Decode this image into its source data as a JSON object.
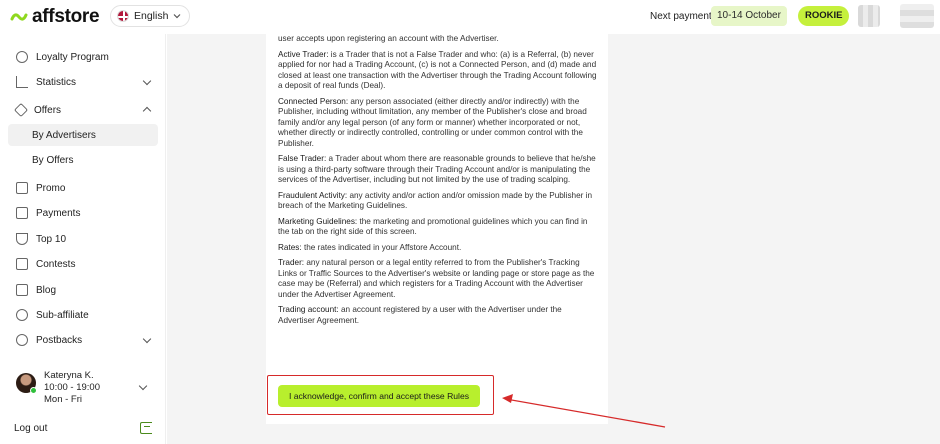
{
  "header": {
    "logo_text": "affstore",
    "language": "English",
    "next_payment_label": "Next payment",
    "next_payment_dates": "10-14 October",
    "rank_badge": "ROOKIE"
  },
  "sidebar": {
    "items": [
      {
        "label": "Loyalty Program",
        "icon": "loyalty-icon"
      },
      {
        "label": "Statistics",
        "icon": "statistics-icon"
      },
      {
        "label": "Offers",
        "icon": "tag-icon"
      },
      {
        "label": "By Advertisers",
        "sub": true,
        "active": true
      },
      {
        "label": "By Offers",
        "sub": true
      },
      {
        "label": "Promo",
        "icon": "image-icon"
      },
      {
        "label": "Payments",
        "icon": "wallet-icon"
      },
      {
        "label": "Top 10",
        "icon": "trophy-icon"
      },
      {
        "label": "Contests",
        "icon": "contests-icon"
      },
      {
        "label": "Blog",
        "icon": "blog-icon"
      },
      {
        "label": "Sub-affiliate",
        "icon": "users-icon"
      },
      {
        "label": "Postbacks",
        "icon": "code-icon"
      }
    ],
    "manager": {
      "name": "Kateryna K.",
      "hours": "10:00 - 19:00",
      "days": "Mon - Fri"
    },
    "logout_label": "Log out"
  },
  "terms": {
    "intro_tail": "user accepts upon registering an account with the Advertiser.",
    "items": [
      {
        "term": "Active Trader:",
        "text": " is a Trader that is not a False Trader and who: (a) is a Referral, (b) never applied for nor had a Trading Account, (c) is not a Connected Person, and (d) made and closed at least one transaction with the Advertiser through the Trading Account following a deposit of real funds (Deal)."
      },
      {
        "term": "Connected Person:",
        "text": " any person associated (either directly and/or indirectly) with the Publisher, including without limitation, any member of the Publisher's close and broad family and/or any legal person (of any form or manner) whether incorporated or not, whether directly or indirectly controlled, controlling or under common control with the Publisher."
      },
      {
        "term": "False Trader:",
        "text": " a Trader about whom there are reasonable grounds to believe that he/she is using a third-party software through their Trading Account and/or is manipulating the services of the Advertiser, including but not limited by the use of trading scalping."
      },
      {
        "term": "Fraudulent Activity:",
        "text": " any activity and/or action and/or omission made by the Publisher in breach of the Marketing Guidelines."
      },
      {
        "term": "Marketing Guidelines:",
        "text": "  the marketing and promotional guidelines which you can find in the tab on the right side of this screen."
      },
      {
        "term": "Rates:",
        "text": " the rates indicated in your Affstore Account."
      },
      {
        "term": "Trader:",
        "text": " any natural person or a legal entity referred to from the Publisher's Tracking Links or Traffic Sources to the Advertiser's website or landing page or store page as the case may be (Referral) and which registers for a Trading Account with the Advertiser under the Advertiser Agreement."
      },
      {
        "term": "Trading account:",
        "text": " an account registered by a user with the Advertiser under the Advertiser Agreement."
      }
    ]
  },
  "accept_button": "I acknowledge, confirm and accept these Rules",
  "colors": {
    "accent": "#b8ef2d",
    "annotation": "#d62a2a",
    "brand": "#8fd81e"
  }
}
